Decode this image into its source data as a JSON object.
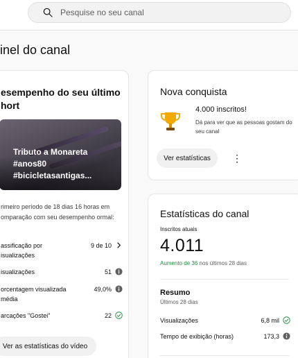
{
  "search": {
    "placeholder": "Pesquise no seu canal",
    "icon": "search-icon"
  },
  "page": {
    "title": "inel do canal"
  },
  "short_card": {
    "title": "esempenho do seu último hort",
    "thumbnail_caption": "Tributo a Monareta #anos80 #bicicletasantigas...",
    "description": "rimeiro período de 18 dias 16 horas em omparação com seu desempenho ormal:",
    "stats": [
      {
        "label": "assificação por isualizações",
        "value": "9 de 10",
        "icon": "chevron-right-icon"
      },
      {
        "label": "isualizações",
        "value": "51",
        "icon": "info-icon"
      },
      {
        "label": "orcentagem visualizada média",
        "value": "49,0%",
        "icon": "info-icon"
      },
      {
        "label": "arcações \"Gostei\"",
        "value": "22",
        "icon": "check-circle-icon"
      }
    ],
    "button_label": "Ver as estatísticas do vídeo"
  },
  "achievement": {
    "title": "Nova conquista",
    "headline": "4.000 inscritos!",
    "message": "Dá para ver que as pessoas gostam do seu canal",
    "button_label": "Ver estatísticas",
    "more_label": "⋮"
  },
  "channel_stats": {
    "title": "Estatísticas do canal",
    "subscribers_label": "Inscritos atuais",
    "subscribers_value": "4.011",
    "growth_highlight": "Aumento de 36",
    "growth_rest": " nos últimos 28 dias",
    "summary_title": "Resumo",
    "summary_period": "Últimos 28 dias",
    "rows": [
      {
        "label": "Visualizações",
        "value": "6,8 mil",
        "icon": "check-circle-icon"
      },
      {
        "label": "Tempo de exibição (horas)",
        "value": "173,3",
        "icon": "info-icon"
      }
    ]
  },
  "colors": {
    "positive": "#1e8e3e",
    "info_icon": "#606060",
    "surface": "#ffffff",
    "background": "#f9f9f9"
  }
}
